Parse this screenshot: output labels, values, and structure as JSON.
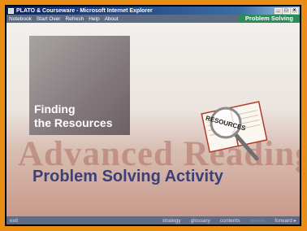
{
  "window": {
    "title": "PLATO & Courseware - Microsoft Internet Explorer",
    "controls": [
      "_",
      "□",
      "×"
    ]
  },
  "menu": {
    "items": [
      "Notebook",
      "Start Over",
      "Refresh",
      "Help",
      "About"
    ],
    "section_badge": "Problem Solving"
  },
  "content": {
    "heading": "Finding\nthe Resources",
    "book_label": "RESOURCES",
    "background_title": "Advanced Reading",
    "activity_title": "Problem Solving Activity"
  },
  "footer": {
    "exit": "exit",
    "nav": [
      "strategy",
      "glossary",
      "contents",
      "review",
      "forward ▸"
    ]
  },
  "colors": {
    "outer_border": "#e98d17",
    "menubar": "#5e6b84",
    "badge": "#2d8a5a",
    "activity_title": "#3c3f78"
  }
}
